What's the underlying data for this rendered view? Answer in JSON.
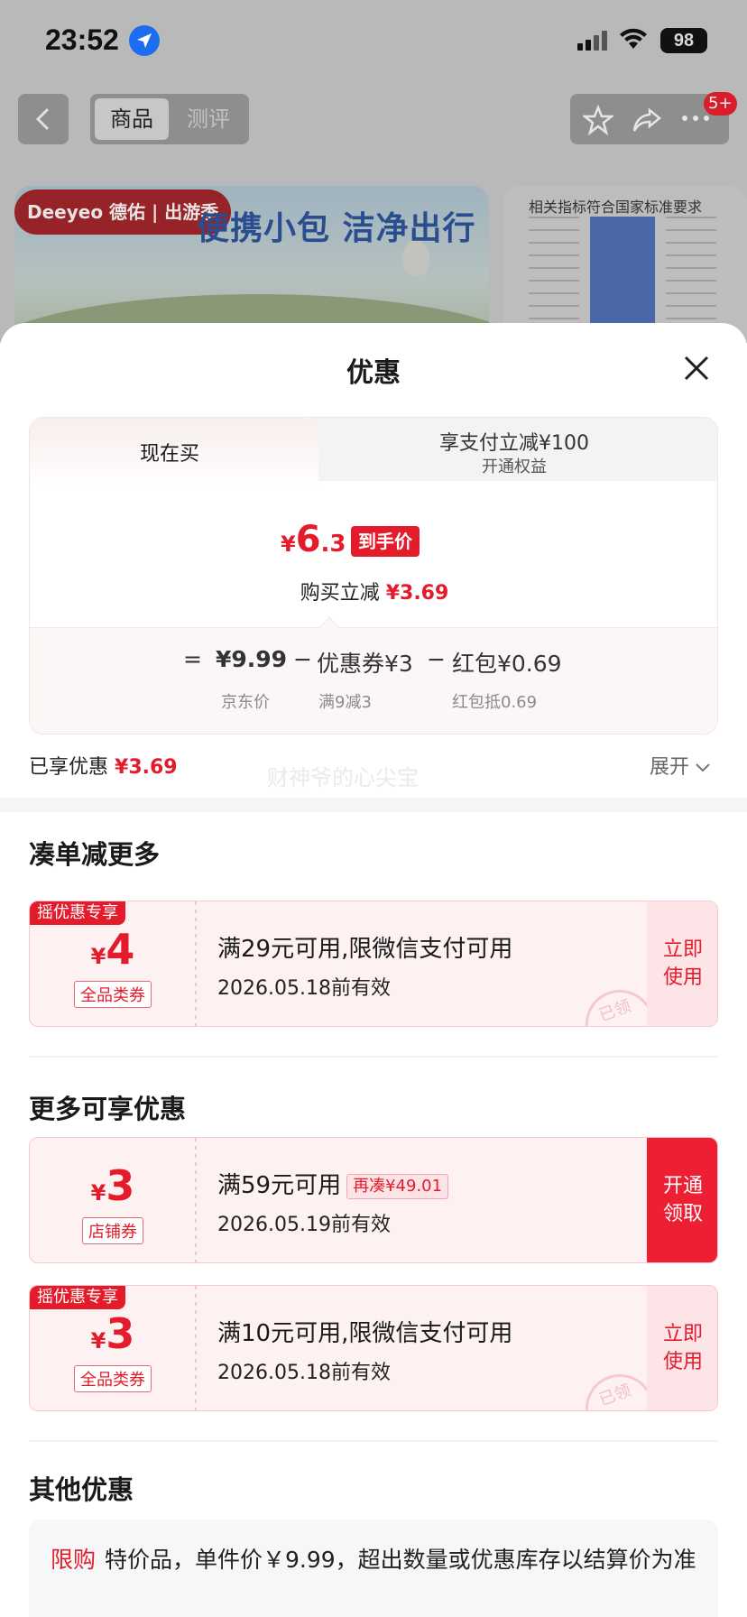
{
  "status_bar": {
    "time": "23:52",
    "battery": "98"
  },
  "nav": {
    "tab_product": "商品",
    "tab_review": "测评",
    "badge": "5+"
  },
  "banner": {
    "brand": "Deeyeo 德佑 | 出游季",
    "title": "便携小包 洁净出行",
    "side_title": "相关指标符合国家标准要求"
  },
  "sheet": {
    "title": "优惠",
    "tab_now": "现在买",
    "tab_pay_line1": "享支付立减¥100",
    "tab_pay_line2": "开通权益",
    "final_price": {
      "yen": "¥",
      "int": "6",
      "dec": ".3"
    },
    "final_label": "到手价",
    "instant_label": "购买立减",
    "instant_value": "¥3.69",
    "breakdown": {
      "eq": "=",
      "jd_price": "¥9.99",
      "minus1": "−",
      "coupon": "优惠券¥3",
      "minus2": "−",
      "redpacket": "红包¥0.69",
      "jd_price_label": "京东价",
      "coupon_label": "满9减3",
      "redpacket_label": "红包抵0.69"
    },
    "enjoyed_label": "已享优惠",
    "enjoyed_value": "¥3.69",
    "watermark": "财神爷的心尖宝",
    "expand": "展开"
  },
  "sections": {
    "combine": "凑单减更多",
    "more": "更多可享优惠",
    "other": "其他优惠"
  },
  "coupons": [
    {
      "tag": "摇优惠专享",
      "yen": "¥",
      "amount": "4",
      "scope": "全品类券",
      "main": "满29元可用,限微信支付可用",
      "date": "2026.05.18前有效",
      "action": "立即使用",
      "stamp": "已领"
    },
    {
      "tag": "",
      "yen": "¥",
      "amount": "3",
      "scope": "店铺券",
      "main": "满59元可用",
      "chip": "再凑¥49.01",
      "date": "2026.05.19前有效",
      "action": "开通领取"
    },
    {
      "tag": "摇优惠专享",
      "yen": "¥",
      "amount": "3",
      "scope": "全品类券",
      "main": "满10元可用,限微信支付可用",
      "date": "2026.05.18前有效",
      "action": "立即使用",
      "stamp": "已领"
    }
  ],
  "other": {
    "label": "限购",
    "text": "特价品，单件价￥9.99，超出数量或优惠库存以结算价为准"
  },
  "colors": {
    "accent": "#e31b2b",
    "coupon_bg": "#fdf1f2"
  }
}
